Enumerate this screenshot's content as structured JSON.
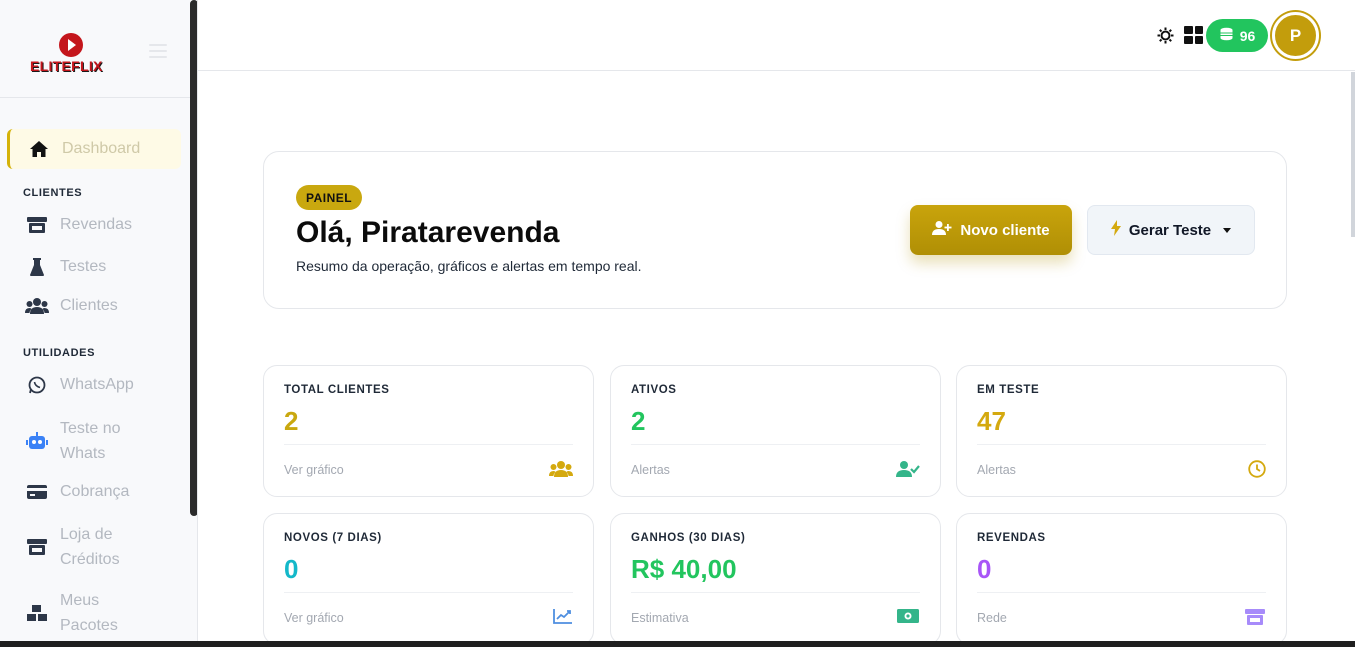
{
  "brand": {
    "name": "ELITEFLIX"
  },
  "sidebar": {
    "active": {
      "label": "Dashboard",
      "icon": "home-icon"
    },
    "sections": [
      {
        "title": "CLIENTES",
        "items": [
          {
            "label": "Revendas",
            "icon": "store-icon"
          },
          {
            "label": "Testes",
            "icon": "flask-icon"
          },
          {
            "label": "Clientes",
            "icon": "users-icon"
          }
        ]
      },
      {
        "title": "UTILIDADES",
        "items": [
          {
            "label": "WhatsApp",
            "icon": "whatsapp-icon"
          },
          {
            "label": "Teste no Whats",
            "icon": "robot-icon"
          },
          {
            "label": "Cobrança",
            "icon": "credit-card-icon"
          },
          {
            "label": "Loja de Créditos",
            "icon": "store-icon"
          },
          {
            "label": "Meus Pacotes",
            "icon": "boxes-icon"
          }
        ]
      }
    ]
  },
  "topbar": {
    "credits": "96",
    "avatar_initial": "P"
  },
  "hero": {
    "badge": "PAINEL",
    "title": "Olá, Piratarevenda",
    "subtitle": "Resumo da operação, gráficos e alertas em tempo real.",
    "primary_button": "Novo cliente",
    "secondary_button": "Gerar Teste"
  },
  "stats": [
    {
      "label": "TOTAL CLIENTES",
      "value": "2",
      "foot": "Ver gráfico",
      "color": "#c9a80f",
      "icon": "users-icon"
    },
    {
      "label": "ATIVOS",
      "value": "2",
      "foot": "Alertas",
      "color": "#22c55e",
      "icon": "user-check-icon"
    },
    {
      "label": "EM TESTE",
      "value": "47",
      "foot": "Alertas",
      "color": "#d4a90f",
      "icon": "clock-icon"
    },
    {
      "label": "NOVOS (7 DIAS)",
      "value": "0",
      "foot": "Ver gráfico",
      "color": "#14b8c9",
      "icon": "chart-line-icon"
    },
    {
      "label": "GANHOS (30 DIAS)",
      "value": "R$ 40,00",
      "foot": "Estimativa",
      "color": "#22c55e",
      "icon": "money-icon"
    },
    {
      "label": "REVENDAS",
      "value": "0",
      "foot": "Rede",
      "color": "#a855f7",
      "icon": "store-icon"
    }
  ]
}
